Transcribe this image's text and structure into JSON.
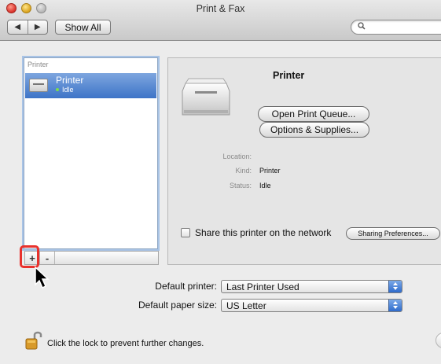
{
  "window": {
    "title": "Print & Fax"
  },
  "toolbar": {
    "back_icon": "◀",
    "forward_icon": "▶",
    "show_all_label": "Show All",
    "search_placeholder": ""
  },
  "printers_list": {
    "header": "Printer",
    "items": [
      {
        "name": "Printer",
        "status": "Idle",
        "status_color": "#7cdc4c"
      }
    ],
    "add_label": "+",
    "remove_label": "-"
  },
  "detail": {
    "printer_name": "Printer",
    "open_queue_label": "Open Print Queue...",
    "options_label": "Options & Supplies...",
    "location_label": "Location:",
    "location_value": "",
    "kind_label": "Kind:",
    "kind_value": "Printer",
    "status_label": "Status:",
    "status_value": "Idle",
    "share_label": "Share this printer on the network",
    "share_checked": false,
    "sharing_prefs_label": "Sharing Preferences..."
  },
  "defaults": {
    "default_printer_label": "Default printer:",
    "default_printer_value": "Last Printer Used",
    "default_paper_label": "Default paper size:",
    "default_paper_value": "US Letter"
  },
  "footer": {
    "lock_text": "Click the lock to prevent further changes."
  },
  "colors": {
    "selection": "#3d74c7",
    "highlight_annotation": "#e8322d"
  }
}
